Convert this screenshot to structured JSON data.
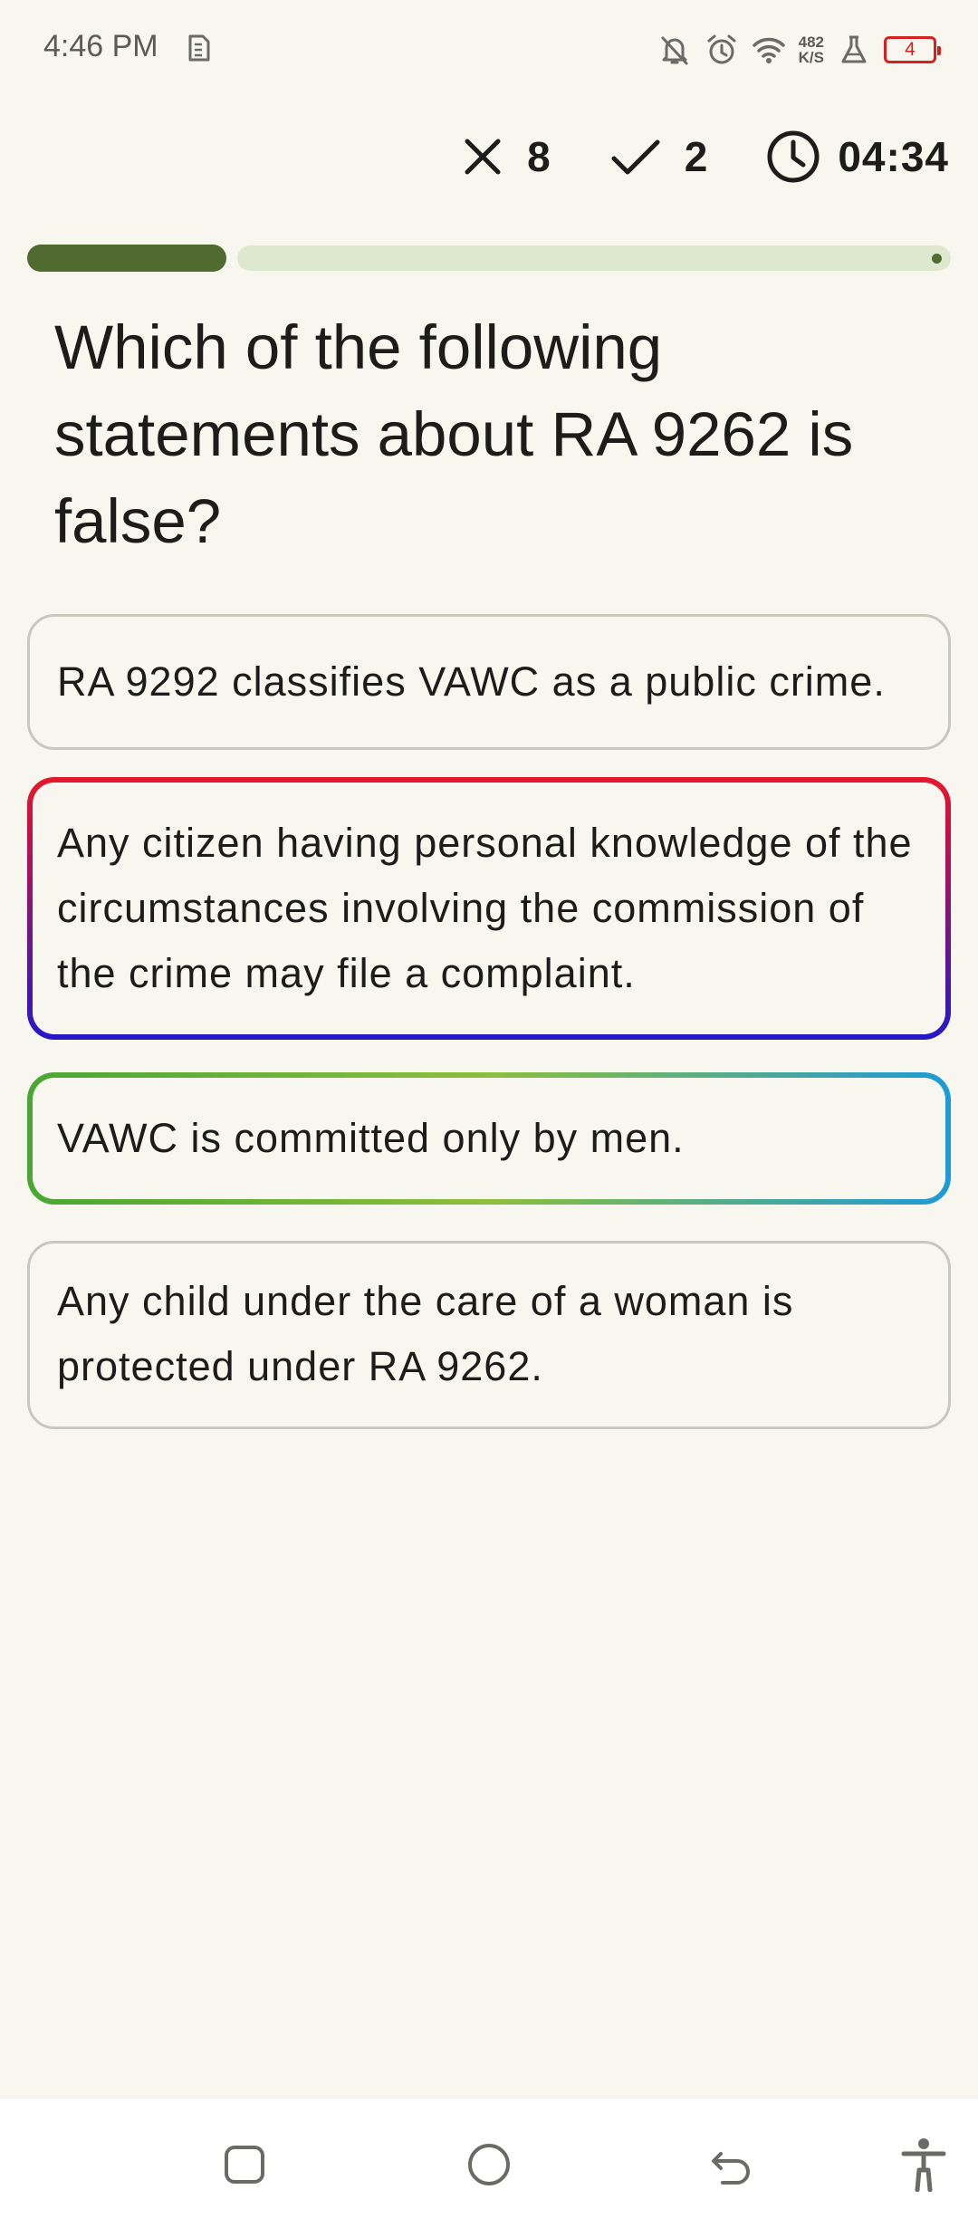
{
  "status_bar": {
    "time": "4:46 PM",
    "net_speed_value": "482",
    "net_speed_unit": "K/S",
    "battery_level": "4",
    "icons": [
      "sim-icon",
      "mute-bell-icon",
      "alarm-icon",
      "wifi-icon",
      "lab-flask-icon",
      "battery-icon"
    ]
  },
  "quiz": {
    "wrong_count": "8",
    "right_count": "2",
    "timer": "04:34",
    "progress": {
      "current": 2,
      "total": 10,
      "fraction": 0.2
    },
    "question": "Which of the following statements about RA 9262 is false?",
    "options": [
      {
        "text": "RA 9292 classifies VAWC as a public crime.",
        "state": "default"
      },
      {
        "text": "Any citizen having personal knowledge of the circumstances involving the commission of the crime may file a complaint.",
        "state": "wrong"
      },
      {
        "text": "VAWC is committed only by men.",
        "state": "correct"
      },
      {
        "text": "Any child under the care of a woman is protected under RA 9262.",
        "state": "default"
      }
    ]
  },
  "colors": {
    "background": "#f7f7f0",
    "progress_fill": "#4f6b30",
    "progress_track": "#dde8cf",
    "wrong_border": "#e5192c",
    "correct_border": "#4aa634",
    "battery_low": "#d42020"
  },
  "nav_bar": {
    "icons": [
      "recent-apps-icon",
      "home-icon",
      "back-icon",
      "accessibility-icon"
    ]
  }
}
